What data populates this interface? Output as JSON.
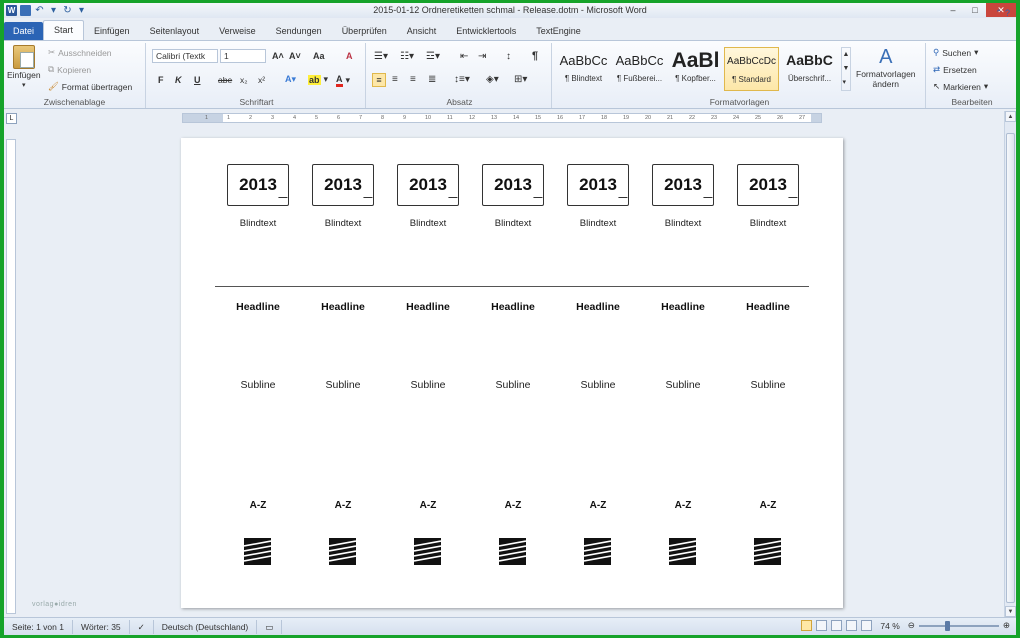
{
  "window": {
    "title": "2015-01-12 Ordneretiketten schmal - Release.dotm - Microsoft Word",
    "minimize": "–",
    "maximize": "□",
    "close": "✕"
  },
  "qat": {
    "app_icon": "W",
    "undo": "↶",
    "redo": "↻",
    "customize": "▾"
  },
  "tabs": [
    {
      "label": "Datei"
    },
    {
      "label": "Start"
    },
    {
      "label": "Einfügen"
    },
    {
      "label": "Seitenlayout"
    },
    {
      "label": "Verweise"
    },
    {
      "label": "Sendungen"
    },
    {
      "label": "Überprüfen"
    },
    {
      "label": "Ansicht"
    },
    {
      "label": "Entwicklertools"
    },
    {
      "label": "TextEngine"
    }
  ],
  "ribbon": {
    "clipboard": {
      "label": "Zwischenablage",
      "paste": "Einfügen",
      "cut": "Ausschneiden",
      "copy": "Kopieren",
      "format_painter": "Format übertragen"
    },
    "font": {
      "label": "Schriftart",
      "family": "Calibri (Textk",
      "size": "1",
      "bold": "F",
      "italic": "K",
      "underline": "U",
      "strike": "abe",
      "sub": "x₂",
      "sup": "x²",
      "grow": "A˄",
      "shrink": "A˅",
      "case": "Aa",
      "clear": "A"
    },
    "paragraph": {
      "label": "Absatz",
      "pilcrow": "¶"
    },
    "styles": {
      "label": "Formatvorlagen",
      "items": [
        {
          "sample": "AaBbCc",
          "name": "¶ Blindtext"
        },
        {
          "sample": "AaBbCc",
          "name": "¶ Fußberei..."
        },
        {
          "sample": "AaBl",
          "name": "¶ Kopfber..."
        },
        {
          "sample": "AaBbCcDc",
          "name": "¶ Standard"
        },
        {
          "sample": "AaBbC",
          "name": "Überschrif..."
        }
      ],
      "change_styles": "Formatvorlagen",
      "change_styles_sub": "ändern"
    },
    "editing": {
      "label": "Bearbeiten",
      "find": "Suchen",
      "replace": "Ersetzen",
      "select": "Markieren"
    }
  },
  "document": {
    "columns": [
      {
        "year": "2013",
        "blind": "Blindtext",
        "headline": "Headline",
        "subline": "Subline",
        "az": "A-Z"
      },
      {
        "year": "2013",
        "blind": "Blindtext",
        "headline": "Headline",
        "subline": "Subline",
        "az": "A-Z"
      },
      {
        "year": "2013",
        "blind": "Blindtext",
        "headline": "Headline",
        "subline": "Subline",
        "az": "A-Z"
      },
      {
        "year": "2013",
        "blind": "Blindtext",
        "headline": "Headline",
        "subline": "Subline",
        "az": "A-Z"
      },
      {
        "year": "2013",
        "blind": "Blindtext",
        "headline": "Headline",
        "subline": "Subline",
        "az": "A-Z"
      },
      {
        "year": "2013",
        "blind": "Blindtext",
        "headline": "Headline",
        "subline": "Subline",
        "az": "A-Z"
      },
      {
        "year": "2013",
        "blind": "Blindtext",
        "headline": "Headline",
        "subline": "Subline",
        "az": "A-Z"
      }
    ],
    "watermark": "vorlag●idren"
  },
  "status": {
    "page": "Seite: 1 von 1",
    "words": "Wörter: 35",
    "language": "Deutsch (Deutschland)",
    "zoom": "74 %",
    "zoom_level": 74
  },
  "ruler_ticks": [
    "1",
    "1",
    "2",
    "3",
    "4",
    "5",
    "6",
    "7",
    "8",
    "9",
    "10",
    "11",
    "12",
    "13",
    "14",
    "15",
    "16",
    "17",
    "18",
    "19",
    "20",
    "21",
    "22",
    "23",
    "24",
    "25",
    "26",
    "27"
  ]
}
